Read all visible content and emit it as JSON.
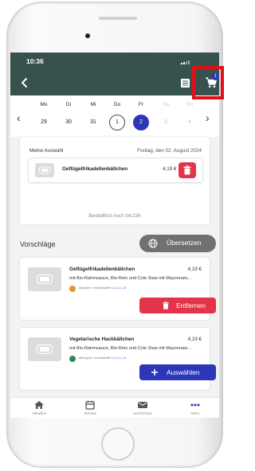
{
  "status": {
    "time": "10:36"
  },
  "header": {
    "back_icon": "back-chevron-icon",
    "list_icon": "list-icon",
    "cart_icon": "cart-icon",
    "cart_count": "1"
  },
  "datestrip": {
    "days": [
      {
        "name": "Mo",
        "num": "29"
      },
      {
        "name": "Di",
        "num": "30"
      },
      {
        "name": "Mi",
        "num": "31"
      },
      {
        "name": "Do",
        "num": "1"
      },
      {
        "name": "Fr",
        "num": "2"
      },
      {
        "name": "Sa",
        "num": "3"
      },
      {
        "name": "So",
        "num": "4"
      }
    ]
  },
  "selection": {
    "title": "Meine Auswahl",
    "date": "Freitag, den 02. August 2024",
    "item_name": "Geflügelfrikadellenbällchen",
    "item_price": "4,19 €",
    "deadline": "Bestellfrist noch 04:23h"
  },
  "suggestions": {
    "title": "Vorschläge",
    "translate_label": "Übersetzen",
    "items": [
      {
        "name": "Geflügelfrikadellenbällchen",
        "price": "4,19 €",
        "desc": "mit Bio-Rahmsauce, Bio-Reis und Cole Slaw mit Mayonnais...",
        "allergen_label": "Allergene / Inhaltsstoffe",
        "allergen_codes": "1,A,C,I,L,N",
        "action": "Entfernen"
      },
      {
        "name": "Vegetarische Hackbällchen",
        "price": "4,19 €",
        "desc": "mit Bio-Rahmsauce, Bio-Reis und Cole Slaw mit Mayonnais...",
        "allergen_label": "Allergene / Inhaltsstoffe",
        "allergen_codes": "1,A,C,I,L,N",
        "action": "Auswählen"
      }
    ]
  },
  "nav": {
    "items": [
      {
        "label": "Aktuelles",
        "icon": "home-icon"
      },
      {
        "label": "Termine",
        "icon": "calendar-icon"
      },
      {
        "label": "Nachrichten",
        "icon": "mail-icon"
      },
      {
        "label": "Mehr",
        "icon": "more-icon"
      }
    ]
  },
  "colors": {
    "header": "#37514f",
    "primary": "#2d36b8",
    "danger": "#e3344a",
    "highlight": "#e30e17"
  }
}
